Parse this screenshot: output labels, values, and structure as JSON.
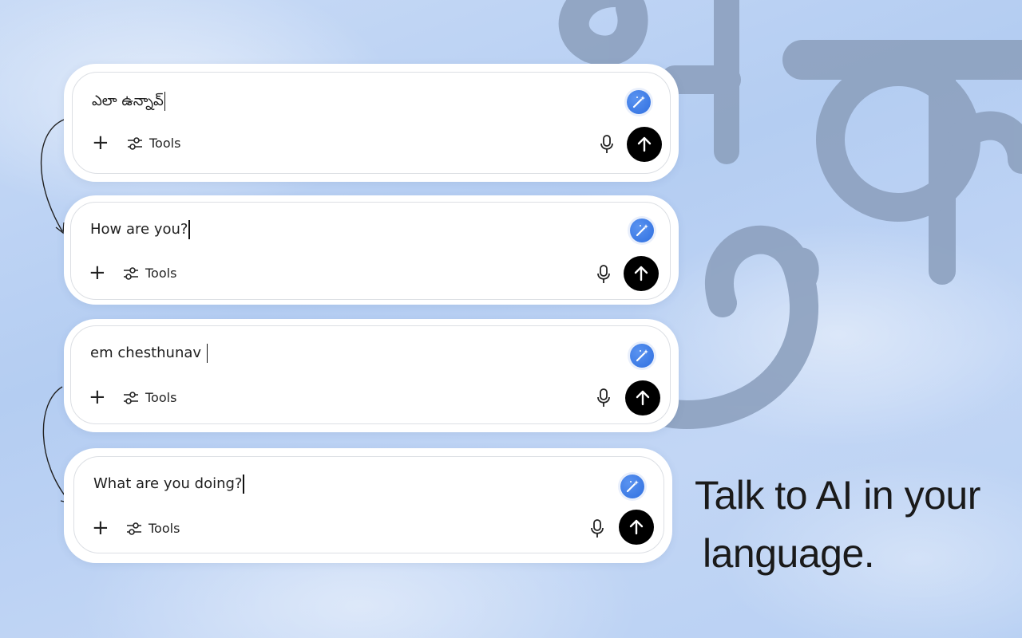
{
  "cards": [
    {
      "text": "ఎలా ఉన్నావ్",
      "tools_label": "Tools"
    },
    {
      "text": "How are you?",
      "tools_label": "Tools"
    },
    {
      "text": "em chesthunav ",
      "tools_label": "Tools"
    },
    {
      "text": "What are you doing?",
      "tools_label": "Tools"
    }
  ],
  "tagline": {
    "line1": "Talk to AI in your",
    "line2": "language."
  },
  "icons": {
    "plus": "plus-icon",
    "tools": "sliders-icon",
    "mic": "microphone-icon",
    "send": "arrow-up-icon",
    "magic": "magic-wand-icon"
  },
  "colors": {
    "glyph": "#8a9fbd",
    "send_bg": "#000000",
    "magic_bg": "#2f6fe0"
  }
}
